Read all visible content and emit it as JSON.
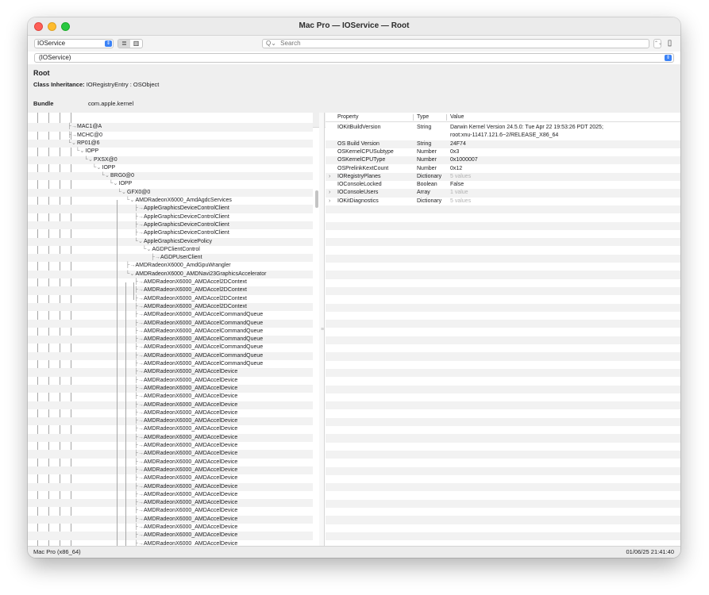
{
  "window": {
    "title": "Mac Pro — IOService — Root"
  },
  "toolbar": {
    "plane": "IOService",
    "view_list_icon": "≣",
    "view_column_icon": "▥",
    "search_placeholder": "Search",
    "search_icon": "Q⌄",
    "stepper_icon": "⌃⌄",
    "sidebar_icon": "▯"
  },
  "class_filter": {
    "value": "(IOService)"
  },
  "info": {
    "title": "Root",
    "inheritance_label": "Class Inheritance:",
    "inheritance_value": "IORegistryEntry : OSObject",
    "bundle_label": "Bundle",
    "bundle_value": "com.apple.kernel"
  },
  "tree": {
    "rows": [
      {
        "label": "",
        "depth": 0
      },
      {
        "label": "MAC1@A",
        "depth": 0
      },
      {
        "label": "MCHC@0",
        "depth": 0
      },
      {
        "label": "RP01@6",
        "depth": 0,
        "expanded": true
      },
      {
        "label": "IOPP",
        "depth": 1,
        "expanded": true
      },
      {
        "label": "PXSX@0",
        "depth": 2,
        "expanded": true
      },
      {
        "label": "IOPP",
        "depth": 3,
        "expanded": true
      },
      {
        "label": "BRG0@0",
        "depth": 4,
        "expanded": true
      },
      {
        "label": "IOPP",
        "depth": 5,
        "expanded": true
      },
      {
        "label": "GFX0@0",
        "depth": 6,
        "expanded": true
      },
      {
        "label": "AMDRadeonX6000_AmdAgdcServices",
        "depth": 7,
        "expanded": true
      },
      {
        "label": "AppleGraphicsDeviceControlClient",
        "depth": 8
      },
      {
        "label": "AppleGraphicsDeviceControlClient",
        "depth": 8
      },
      {
        "label": "AppleGraphicsDeviceControlClient",
        "depth": 8
      },
      {
        "label": "AppleGraphicsDeviceControlClient",
        "depth": 8
      },
      {
        "label": "AppleGraphicsDevicePolicy",
        "depth": 8,
        "expanded": true
      },
      {
        "label": "AGDPClientControl",
        "depth": 9,
        "expanded": true
      },
      {
        "label": "AGDPUserClient",
        "depth": 10
      },
      {
        "label": "AMDRadeonX6000_AmdGpuWrangler",
        "depth": 7
      },
      {
        "label": "AMDRadeonX6000_AMDNavi23GraphicsAccelerator",
        "depth": 7,
        "expanded": true
      },
      {
        "label": "AMDRadeonX6000_AMDAccel2DContext",
        "depth": 8
      },
      {
        "label": "AMDRadeonX6000_AMDAccel2DContext",
        "depth": 8
      },
      {
        "label": "AMDRadeonX6000_AMDAccel2DContext",
        "depth": 8
      },
      {
        "label": "AMDRadeonX6000_AMDAccel2DContext",
        "depth": 8
      },
      {
        "label": "AMDRadeonX6000_AMDAccelCommandQueue",
        "depth": 8
      },
      {
        "label": "AMDRadeonX6000_AMDAccelCommandQueue",
        "depth": 8
      },
      {
        "label": "AMDRadeonX6000_AMDAccelCommandQueue",
        "depth": 8
      },
      {
        "label": "AMDRadeonX6000_AMDAccelCommandQueue",
        "depth": 8
      },
      {
        "label": "AMDRadeonX6000_AMDAccelCommandQueue",
        "depth": 8
      },
      {
        "label": "AMDRadeonX6000_AMDAccelCommandQueue",
        "depth": 8
      },
      {
        "label": "AMDRadeonX6000_AMDAccelCommandQueue",
        "depth": 8
      },
      {
        "label": "AMDRadeonX6000_AMDAccelDevice",
        "depth": 8
      },
      {
        "label": "AMDRadeonX6000_AMDAccelDevice",
        "depth": 8
      },
      {
        "label": "AMDRadeonX6000_AMDAccelDevice",
        "depth": 8
      },
      {
        "label": "AMDRadeonX6000_AMDAccelDevice",
        "depth": 8
      },
      {
        "label": "AMDRadeonX6000_AMDAccelDevice",
        "depth": 8
      },
      {
        "label": "AMDRadeonX6000_AMDAccelDevice",
        "depth": 8
      },
      {
        "label": "AMDRadeonX6000_AMDAccelDevice",
        "depth": 8
      },
      {
        "label": "AMDRadeonX6000_AMDAccelDevice",
        "depth": 8
      },
      {
        "label": "AMDRadeonX6000_AMDAccelDevice",
        "depth": 8
      },
      {
        "label": "AMDRadeonX6000_AMDAccelDevice",
        "depth": 8
      },
      {
        "label": "AMDRadeonX6000_AMDAccelDevice",
        "depth": 8
      },
      {
        "label": "AMDRadeonX6000_AMDAccelDevice",
        "depth": 8
      },
      {
        "label": "AMDRadeonX6000_AMDAccelDevice",
        "depth": 8
      },
      {
        "label": "AMDRadeonX6000_AMDAccelDevice",
        "depth": 8
      },
      {
        "label": "AMDRadeonX6000_AMDAccelDevice",
        "depth": 8
      },
      {
        "label": "AMDRadeonX6000_AMDAccelDevice",
        "depth": 8
      },
      {
        "label": "AMDRadeonX6000_AMDAccelDevice",
        "depth": 8
      },
      {
        "label": "AMDRadeonX6000_AMDAccelDevice",
        "depth": 8
      },
      {
        "label": "AMDRadeonX6000_AMDAccelDevice",
        "depth": 8
      },
      {
        "label": "AMDRadeonX6000_AMDAccelDevice",
        "depth": 8
      },
      {
        "label": "AMDRadeonX6000_AMDAccelDevice",
        "depth": 8
      },
      {
        "label": "AMDRadeonX6000_AMDAccelDevice",
        "depth": 8
      }
    ]
  },
  "properties": {
    "headers": {
      "property": "Property",
      "type": "Type",
      "value": "Value"
    },
    "rows": [
      {
        "property": "IOKitBuildVersion",
        "type": "String",
        "value": "Darwin Kernel Version 24.5.0: Tue Apr 22 19:53:26 PDT 2025;",
        "value2": "root:xnu-11417.121.6~2/RELEASE_X86_64"
      },
      {
        "property": "OS Build Version",
        "type": "String",
        "value": "24F74"
      },
      {
        "property": "OSKernelCPUSubtype",
        "type": "Number",
        "value": "0x3"
      },
      {
        "property": "OSKernelCPUType",
        "type": "Number",
        "value": "0x1000007"
      },
      {
        "property": "OSPrelinkKextCount",
        "type": "Number",
        "value": "0x12"
      },
      {
        "property": "IORegistryPlanes",
        "type": "Dictionary",
        "value": "5 values",
        "expandable": true,
        "muted": true
      },
      {
        "property": "IOConsoleLocked",
        "type": "Boolean",
        "value": "False"
      },
      {
        "property": "IOConsoleUsers",
        "type": "Array",
        "value": "1 value",
        "expandable": true,
        "muted": true
      },
      {
        "property": "IOKitDiagnostics",
        "type": "Dictionary",
        "value": "5 values",
        "expandable": true,
        "muted": true
      }
    ]
  },
  "status": {
    "left": "Mac Pro (x86_64)",
    "right": "01/06/25 21:41:40"
  }
}
